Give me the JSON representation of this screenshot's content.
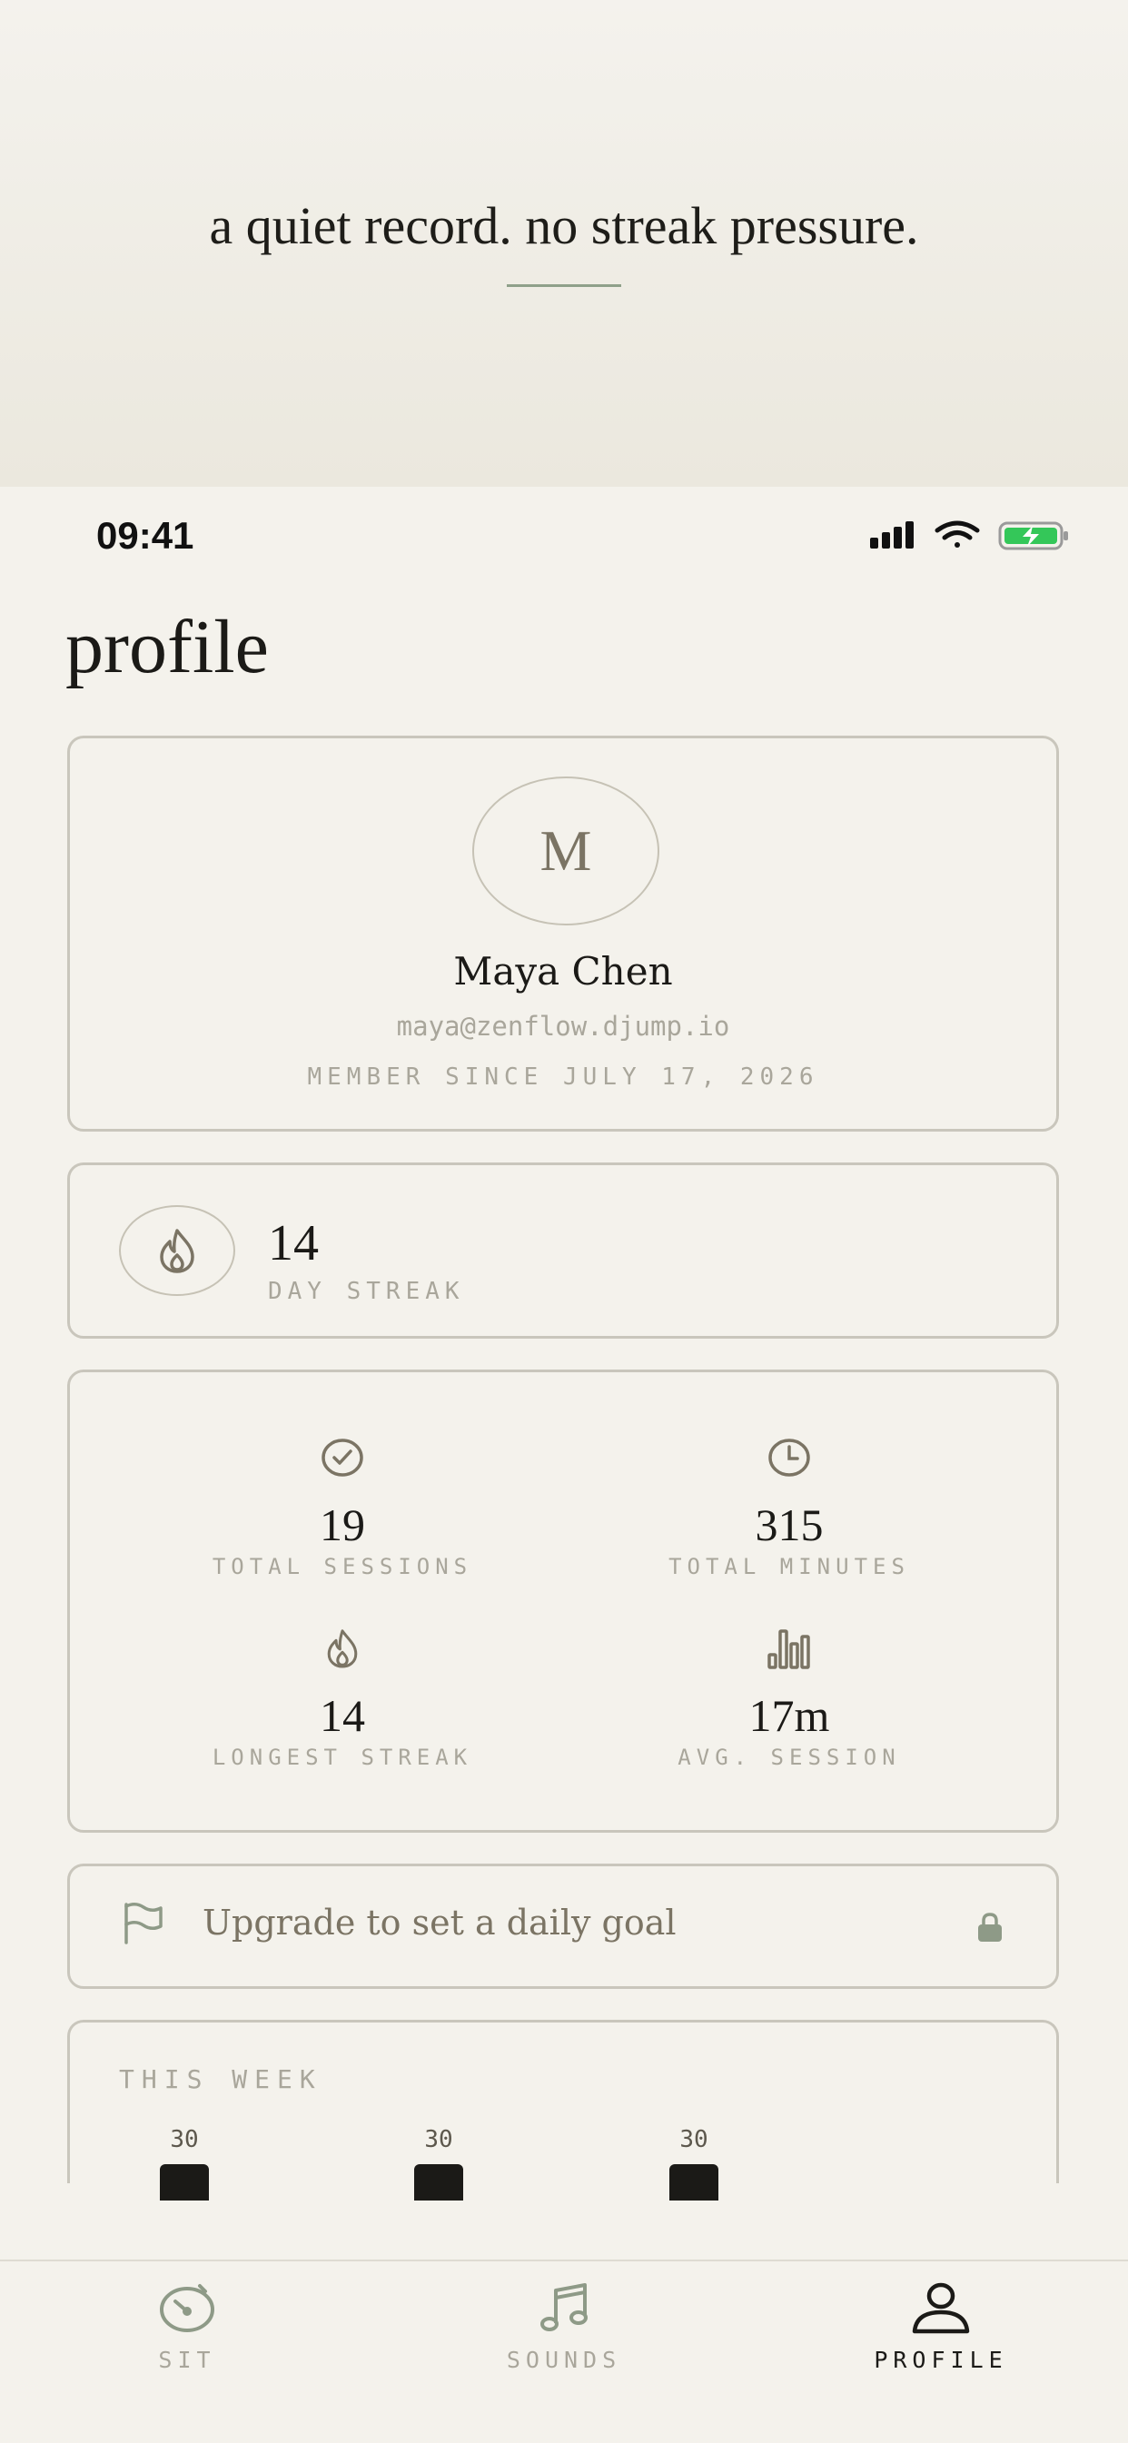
{
  "banner": {
    "tagline": "a quiet record. no streak pressure."
  },
  "status_bar": {
    "time": "09:41",
    "battery_color": "#34c759"
  },
  "page": {
    "title": "profile"
  },
  "profile": {
    "initial": "M",
    "name": "Maya Chen",
    "email": "maya@zenflow.djump.io",
    "member_since": "MEMBER SINCE JULY 17, 2026"
  },
  "streak": {
    "value": "14",
    "label": "DAY STREAK",
    "icon": "flame-icon"
  },
  "stats": [
    {
      "icon": "check-circle-icon",
      "value": "19",
      "label": "TOTAL SESSIONS"
    },
    {
      "icon": "clock-icon",
      "value": "315",
      "label": "TOTAL MINUTES"
    },
    {
      "icon": "flame-icon",
      "value": "14",
      "label": "LONGEST STREAK"
    },
    {
      "icon": "bar-chart-icon",
      "value": "17m",
      "label": "AVG. SESSION"
    }
  ],
  "goal": {
    "label": "Upgrade to set a daily goal",
    "icon": "flag-icon",
    "lock_icon": "lock-icon",
    "lock_color": "#8e9a87"
  },
  "week": {
    "title": "THIS WEEK",
    "bars": [
      {
        "value": "30"
      },
      {
        "value": "30"
      },
      {
        "value": "30"
      }
    ]
  },
  "tabs": [
    {
      "label": "SIT",
      "icon": "timer-icon",
      "active": false
    },
    {
      "label": "SOUNDS",
      "icon": "music-note-icon",
      "active": false
    },
    {
      "label": "PROFILE",
      "icon": "person-icon",
      "active": true
    }
  ],
  "colors": {
    "accent": "#8fa08a",
    "text": "#1b1a17",
    "muted": "#a9a69b",
    "border": "#c9c6bc",
    "background": "#f4f2ec"
  }
}
